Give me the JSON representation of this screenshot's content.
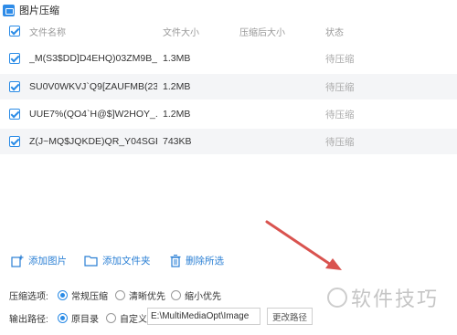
{
  "window": {
    "title": "图片压缩"
  },
  "table": {
    "headers": {
      "name": "文件名称",
      "size": "文件大小",
      "compressed_size": "压缩后大小",
      "status": "状态"
    },
    "rows": [
      {
        "name": "_M(S3$DD]D4EHQ)03ZM9B_...",
        "size": "1.3MB",
        "compressed_size": "",
        "status": "待压缩"
      },
      {
        "name": "SU0V0WKVJ`Q9[ZAUFMB(23...",
        "size": "1.2MB",
        "compressed_size": "",
        "status": "待压缩"
      },
      {
        "name": "UUE7%(QO4`H@$]W2HOY_...",
        "size": "1.2MB",
        "compressed_size": "",
        "status": "待压缩"
      },
      {
        "name": "Z(J~MQ$JQKDE)QR_Y04SGE...",
        "size": "743KB",
        "compressed_size": "",
        "status": "待压缩"
      }
    ]
  },
  "toolbar": {
    "add_image": "添加图片",
    "add_folder": "添加文件夹",
    "clear_list": "删除所选"
  },
  "options": {
    "compress_label": "压缩选项:",
    "compress_choices": [
      "常规压缩",
      "清晰优先",
      "缩小优先"
    ],
    "compress_selected": "常规压缩",
    "output_label": "输出路径:",
    "output_choices": [
      "原目录",
      "自定义"
    ],
    "output_selected": "原目录",
    "output_path": "E:\\MultiMediaOpt\\Image",
    "change_path": "更改路径"
  },
  "watermark": {
    "text": "软件技巧"
  },
  "colors": {
    "accent": "#2a8be6",
    "annotation_arrow": "#d9534f"
  }
}
